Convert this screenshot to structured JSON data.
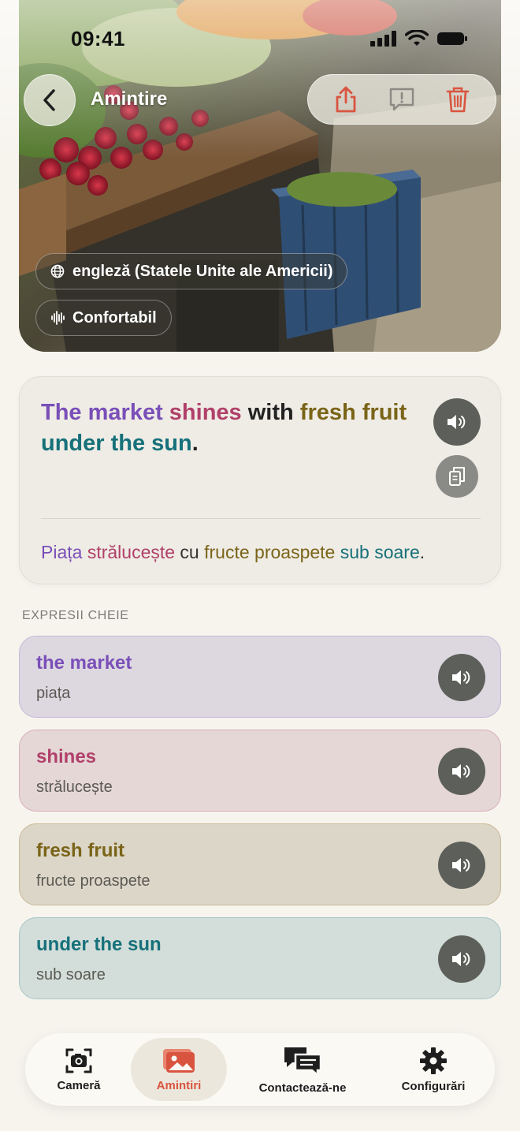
{
  "status": {
    "time": "09:41"
  },
  "header": {
    "title": "Amintire"
  },
  "chips": {
    "language": "engleză (Statele Unite ale Americii)",
    "speed": "Confortabil"
  },
  "sentence": {
    "en": [
      {
        "text": "The market",
        "color": "#7a4fb8"
      },
      {
        "text": " ",
        "color": "#222222"
      },
      {
        "text": "shines",
        "color": "#b0406a"
      },
      {
        "text": " with ",
        "color": "#222222"
      },
      {
        "text": "fresh fruit",
        "color": "#7a6418"
      },
      {
        "text": " ",
        "color": "#222222"
      },
      {
        "text": "under the sun",
        "color": "#16717a"
      },
      {
        "text": ".",
        "color": "#222222"
      }
    ],
    "ro": [
      {
        "text": "Piața",
        "color": "#7a4fb8"
      },
      {
        "text": " ",
        "color": "#333333"
      },
      {
        "text": "strălucește",
        "color": "#b0406a"
      },
      {
        "text": " cu ",
        "color": "#333333"
      },
      {
        "text": "fructe proaspete",
        "color": "#7a6418"
      },
      {
        "text": " ",
        "color": "#333333"
      },
      {
        "text": "sub soare",
        "color": "#16717a"
      },
      {
        "text": ".",
        "color": "#333333"
      }
    ]
  },
  "section_label": "EXPRESII CHEIE",
  "phrases": [
    {
      "en": "the market",
      "ro": "piața",
      "color": "#7a4fb8",
      "bg": "#ddd8e0",
      "border": "#c3b6d9"
    },
    {
      "en": "shines",
      "ro": "strălucește",
      "color": "#b0406a",
      "bg": "#e5d7d6",
      "border": "#d9aebb"
    },
    {
      "en": "fresh fruit",
      "ro": "fructe proaspete",
      "color": "#7a6418",
      "bg": "#dcd6c8",
      "border": "#c8bb95"
    },
    {
      "en": "under the sun",
      "ro": "sub soare",
      "color": "#16717a",
      "bg": "#d3ddd9",
      "border": "#a7c6c8"
    }
  ],
  "nav": {
    "items": [
      {
        "label": "Cameră",
        "icon": "camera-icon"
      },
      {
        "label": "Amintiri",
        "icon": "photos-icon",
        "active": true
      },
      {
        "label": "Contactează-ne",
        "icon": "chat-icon"
      },
      {
        "label": "Configurări",
        "icon": "gear-icon"
      }
    ]
  },
  "colors": {
    "accent": "#d9543f",
    "dark_button": "#5d5f5a"
  }
}
